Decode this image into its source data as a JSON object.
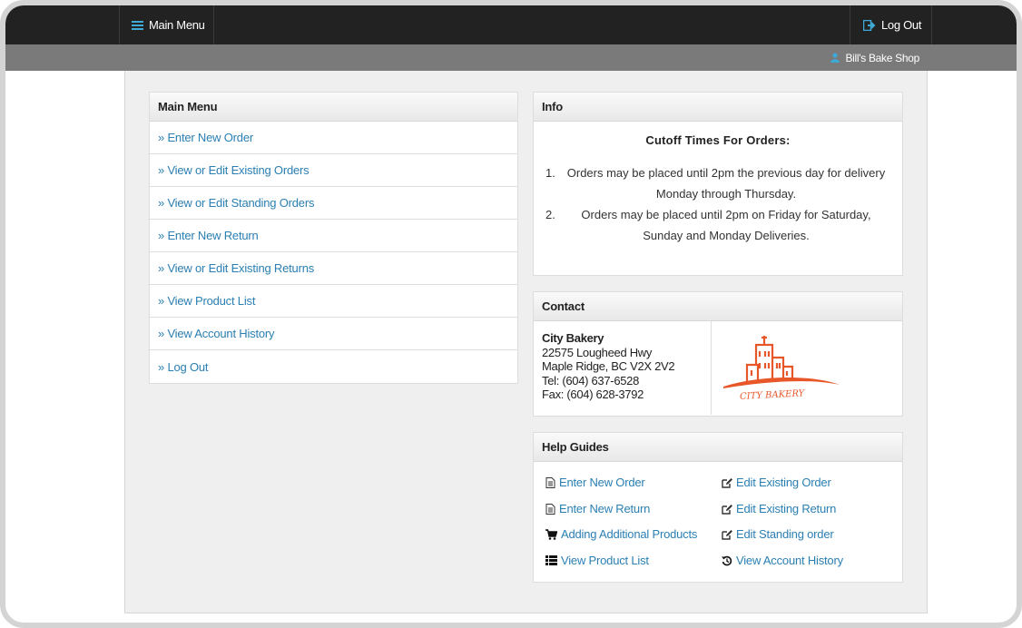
{
  "nav": {
    "main_menu_label": "Main Menu",
    "logout_label": "Log Out",
    "shop_name": "Bill's Bake Shop"
  },
  "main_menu": {
    "title": "Main Menu",
    "items": [
      "» Enter New Order",
      "» View or Edit Existing Orders",
      "» View or Edit Standing Orders",
      "» Enter New Return",
      "» View or Edit Existing Returns",
      "» View Product List",
      "» View Account History",
      "» Log Out"
    ]
  },
  "info": {
    "title": "Info",
    "heading": "Cutoff Times For Orders:",
    "items": [
      {
        "num": "1.",
        "text": "Orders may be placed until 2pm the previous day for delivery Monday through Thursday."
      },
      {
        "num": "2.",
        "text": "Orders may be placed until 2pm on Friday for Saturday, Sunday and Monday Deliveries."
      }
    ]
  },
  "contact": {
    "title": "Contact",
    "name": "City Bakery",
    "address1": "22575 Lougheed Hwy",
    "address2": "Maple Ridge, BC V2X 2V2",
    "tel": "Tel: (604) 637-6528",
    "fax": "Fax: (604) 628-3792",
    "logo_text": "CITY BAKERY"
  },
  "help": {
    "title": "Help Guides",
    "items": [
      {
        "label": "Enter New Order",
        "icon": "document-icon"
      },
      {
        "label": "Edit Existing Order",
        "icon": "edit-icon"
      },
      {
        "label": "Enter New Return",
        "icon": "document-icon"
      },
      {
        "label": "Edit Existing Return",
        "icon": "edit-icon"
      },
      {
        "label": "Adding Additional Products",
        "icon": "cart-icon"
      },
      {
        "label": "Edit Standing order",
        "icon": "edit-icon"
      },
      {
        "label": "View Product List",
        "icon": "list-icon"
      },
      {
        "label": "View Account History",
        "icon": "history-icon"
      }
    ]
  },
  "colors": {
    "accent": "#3fa9d6",
    "link": "#2a7fb3",
    "logo": "#e8572a"
  }
}
